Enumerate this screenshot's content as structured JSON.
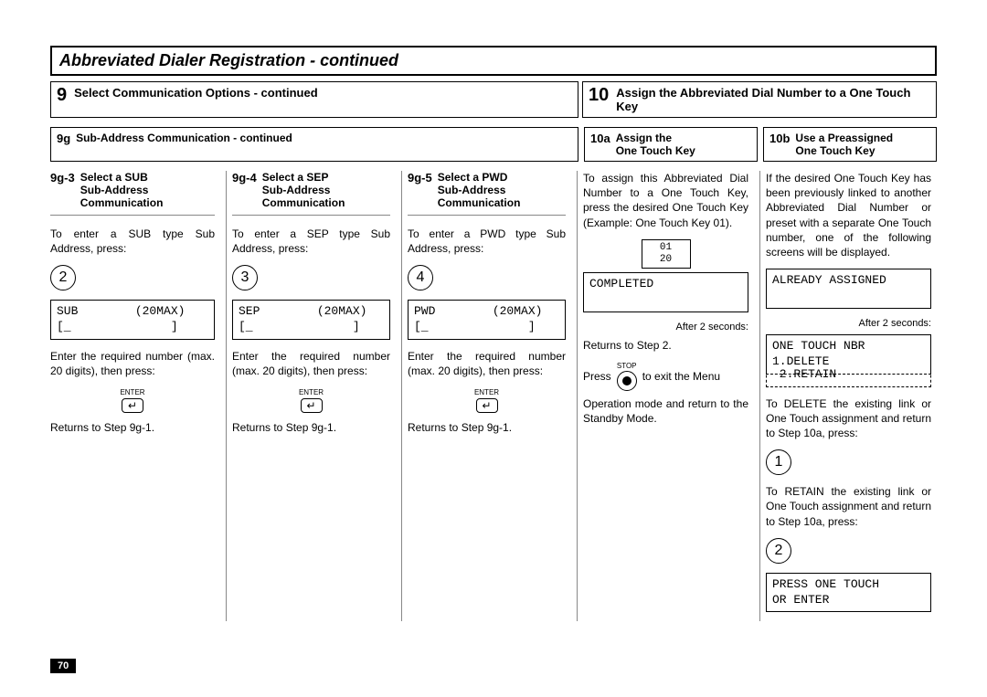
{
  "page_title": "Abbreviated Dialer Registration - continued",
  "page_number": "70",
  "step9": {
    "num": "9",
    "title": "Select Communication Options - continued",
    "sub9g": {
      "code": "9g",
      "title": "Sub-Address Communication - continued"
    },
    "cols": {
      "c1": {
        "code": "9g-3",
        "title": "Select a SUB\nSub-Address\nCommunication",
        "intro": "To enter a SUB type Sub Address, press:",
        "key": "2",
        "lcd": "SUB        (20MAX)\n[_              ]",
        "after": "Enter the required number (max. 20 digits), then press:",
        "enter_label": "ENTER",
        "return": "Returns to Step 9g-1."
      },
      "c2": {
        "code": "9g-4",
        "title": "Select a SEP\nSub-Address\nCommunication",
        "intro": "To enter a SEP type Sub Address, press:",
        "key": "3",
        "lcd": "SEP        (20MAX)\n[_              ]",
        "after": "Enter the required number (max. 20 digits), then press:",
        "enter_label": "ENTER",
        "return": "Returns to Step 9g-1."
      },
      "c3": {
        "code": "9g-5",
        "title": "Select a PWD\nSub-Address\nCommunication",
        "intro": "To enter a PWD type Sub Address, press:",
        "key": "4",
        "lcd": "PWD        (20MAX)\n[_              ]",
        "after": "Enter the required number (max. 20 digits), then press:",
        "enter_label": "ENTER",
        "return": "Returns to Step 9g-1."
      }
    }
  },
  "step10": {
    "num": "10",
    "title": "Assign the Abbreviated Dial Number to a One Touch Key",
    "a": {
      "code": "10a",
      "title": "Assign the\nOne Touch Key",
      "intro": "To assign this Abbreviated Dial Number to a One Touch Key, press the desired One Touch Key (Example: One Touch Key 01).",
      "small_lcd": "01\n20",
      "lcd1": "COMPLETED\n ",
      "after2": "After 2 seconds:",
      "returns": "Returns  to Step 2.",
      "stop_label": "STOP",
      "press": "Press",
      "exit": "to exit the Menu",
      "standby": "Operation mode and return to the Standby Mode."
    },
    "b": {
      "code": "10b",
      "title": "Use a Preassigned\nOne Touch Key",
      "intro": "If the desired One Touch Key has been previously linked to another Abbreviated Dial Number or preset with a separate One Touch number, one of the following screens will be displayed.",
      "lcd1": "ALREADY ASSIGNED\n ",
      "after2": "After 2 seconds:",
      "lcd2": "ONE TOUCH NBR\n1.DELETE",
      "lcd2b": " 2.RETAIN",
      "del": "To DELETE the existing link or One Touch assignment and return to Step 10a, press:",
      "key1": "1",
      "ret": "To RETAIN the existing link or One Touch assignment and return to Step 10a, press:",
      "key2": "2",
      "lcd3": "PRESS ONE TOUCH\nOR ENTER"
    }
  }
}
